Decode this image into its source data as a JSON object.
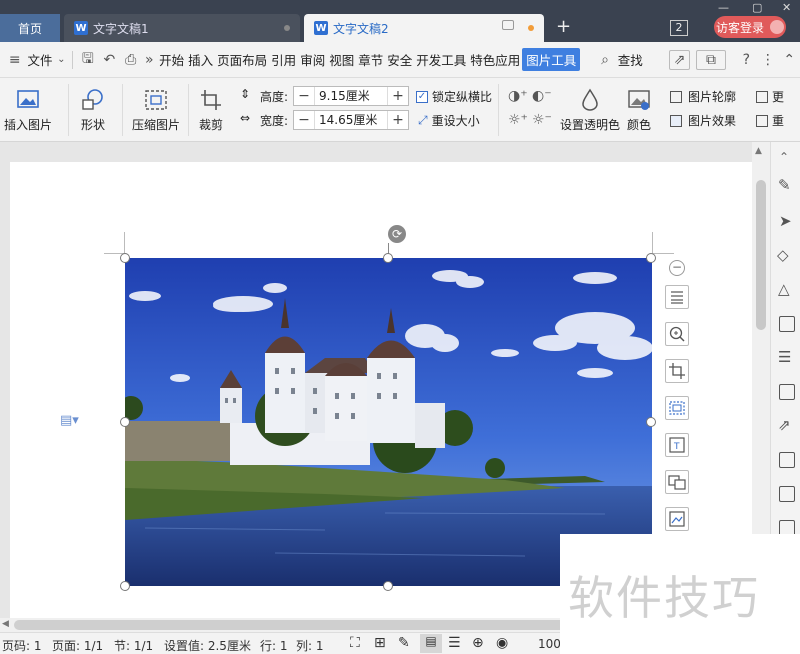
{
  "tabs": {
    "home": "首页",
    "doc1": "文字文稿1",
    "doc2": "文字文稿2",
    "badge": "2",
    "login": "访客登录",
    "w": "W"
  },
  "menu": {
    "file": "文件",
    "items": [
      "开始",
      "插入",
      "页面布局",
      "引用",
      "审阅",
      "视图",
      "章节",
      "安全",
      "开发工具",
      "特色应用",
      "图片工具"
    ],
    "active": "图片工具",
    "search": "查找"
  },
  "ribbon": {
    "insert_image": "插入图片",
    "shape": "形状",
    "compress": "压缩图片",
    "crop": "裁剪",
    "height_label": "高度:",
    "height_value": "9.15厘米",
    "width_label": "宽度:",
    "width_value": "14.65厘米",
    "lock_ratio": "锁定纵横比",
    "reset_size": "重设大小",
    "transparent": "设置透明色",
    "color": "颜色",
    "outline": "图片轮廓",
    "effect": "图片效果",
    "more1": "更",
    "more2": "重"
  },
  "status": {
    "page_no": "页码: 1",
    "pages": "页面: 1/1",
    "section": "节: 1/1",
    "setting": "设置值: 2.5厘米",
    "row": "行: 1",
    "col": "列: 1",
    "zoom": "100"
  },
  "watermark": "软件技巧",
  "colors": {
    "accent": "#3f7fe0",
    "login": "#e05a5a",
    "tabbar": "#3a4250"
  }
}
